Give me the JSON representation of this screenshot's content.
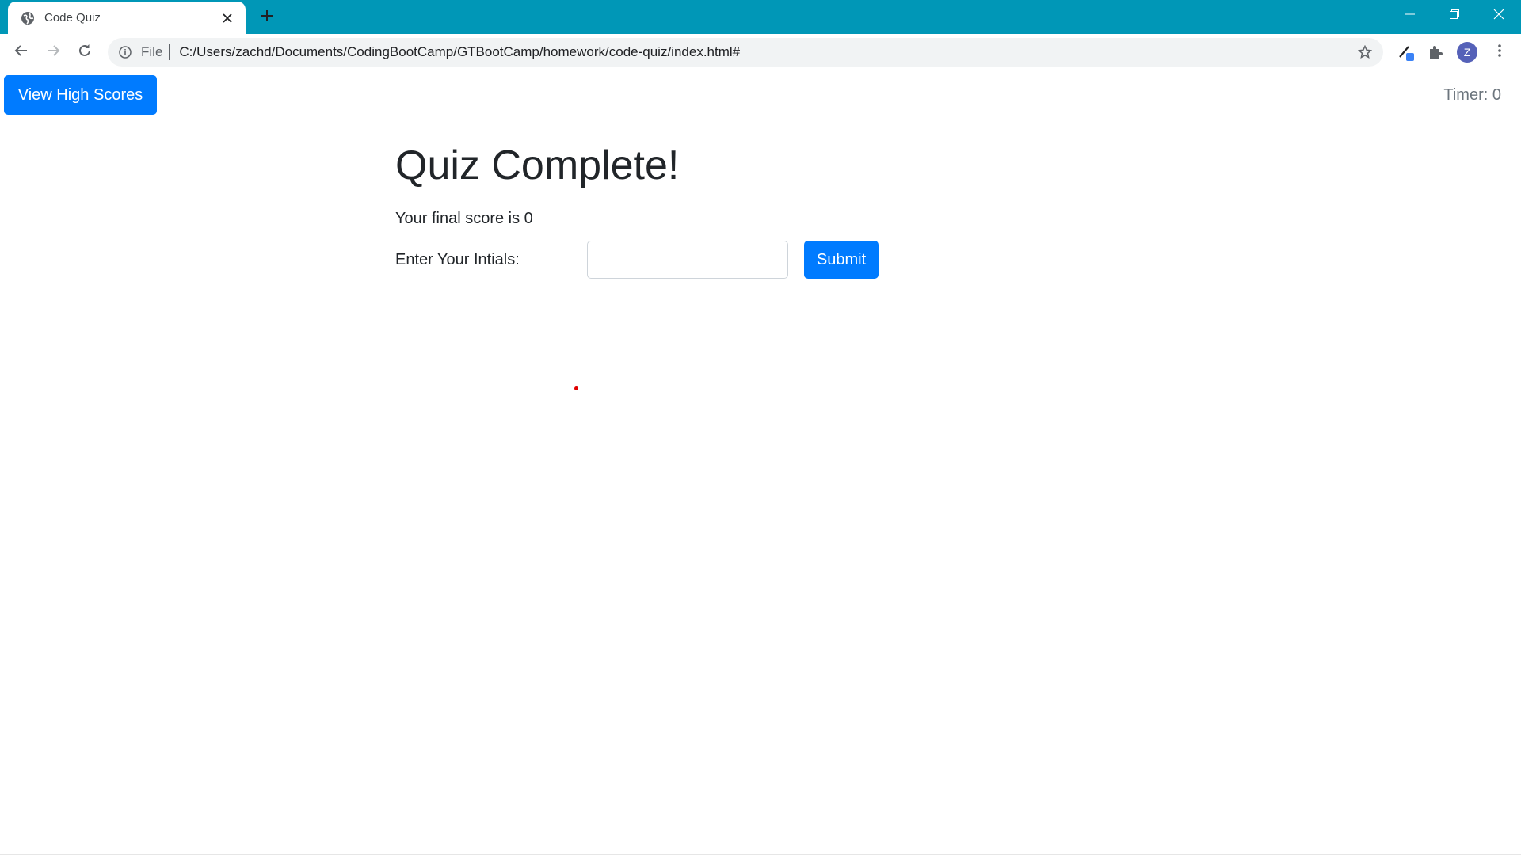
{
  "browser": {
    "tab_title": "Code Quiz",
    "omnibox_scheme_label": "File",
    "url": "C:/Users/zachd/Documents/CodingBootCamp/GTBootCamp/homework/code-quiz/index.html#",
    "profile_initial": "Z",
    "chrome_color": "#0097b7"
  },
  "header": {
    "high_scores_label": "View High Scores",
    "timer_text": "Timer: 0"
  },
  "quiz": {
    "title": "Quiz Complete!",
    "final_score_text": "Your final score is 0",
    "initials_label": "Enter Your Intials:",
    "initials_value": "",
    "submit_label": "Submit"
  },
  "colors": {
    "primary": "#007bff",
    "text": "#212529",
    "muted": "#6c757d"
  }
}
